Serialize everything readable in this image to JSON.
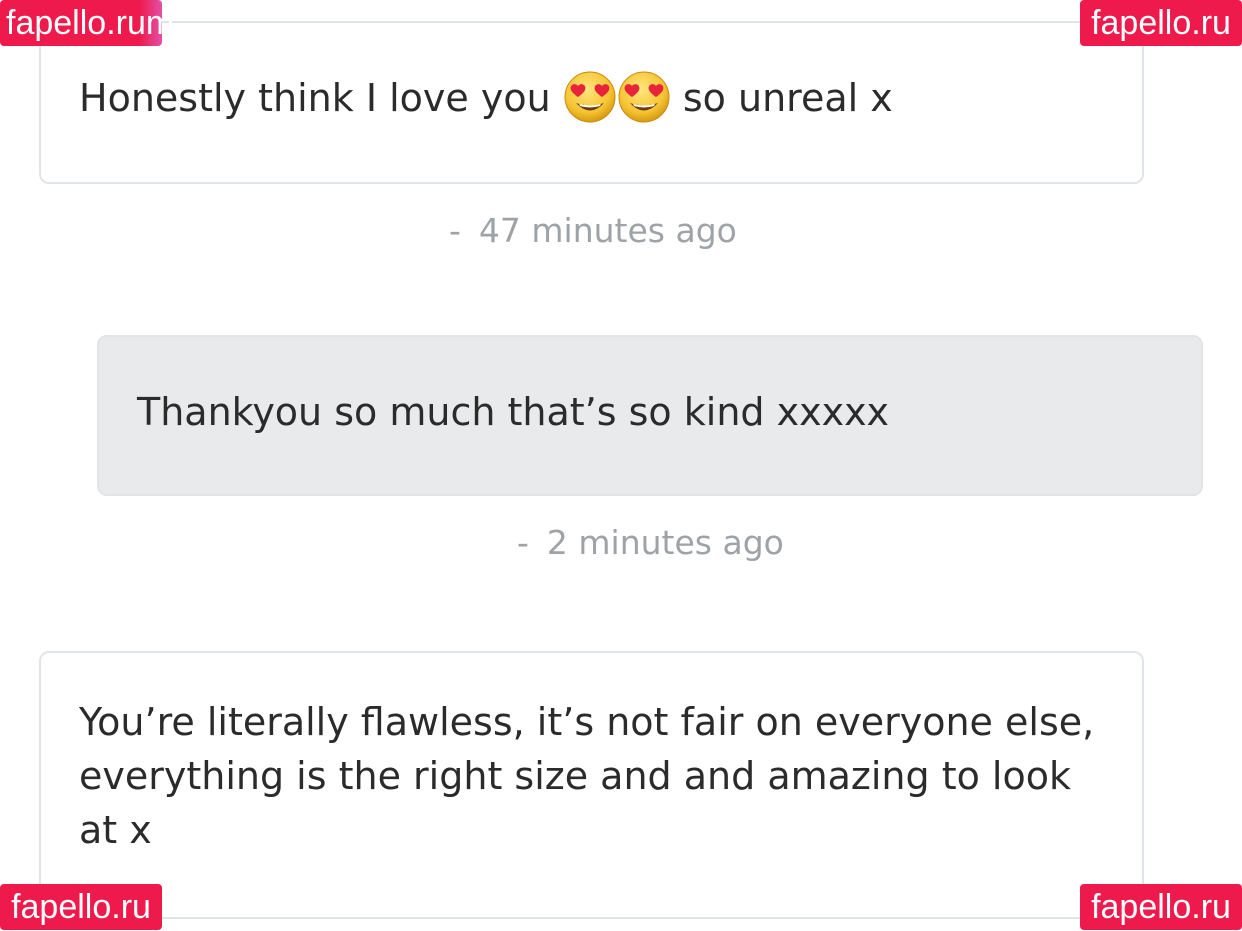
{
  "messages": [
    {
      "type": "incoming",
      "text_before": "Honestly think I love you",
      "emoji": [
        "heart-eyes-emoji",
        "heart-eyes-emoji"
      ],
      "text_after": "so unreal x",
      "timestamp": "47 minutes ago"
    },
    {
      "type": "outgoing",
      "text": "Thankyou so much that’s so kind xxxxx",
      "timestamp": "2 minutes ago"
    },
    {
      "type": "incoming",
      "text": "You’re literally flawless, it’s not fair on everyone else, everything is the right size and and amazing to look at x"
    }
  ],
  "timestamp_prefix": "-",
  "watermarks": {
    "top_left": "fapello.ru",
    "top_left_fragment": "m",
    "top_right": "fapello.ru",
    "bottom_left": "fapello.ru",
    "bottom_right": "fapello.ru"
  },
  "colors": {
    "text": "#2b2b2b",
    "timestamp": "#9ea3a8",
    "incoming_bg": "#ffffff",
    "outgoing_bg": "#e9eaeb",
    "watermark": "#ee1a4c"
  }
}
